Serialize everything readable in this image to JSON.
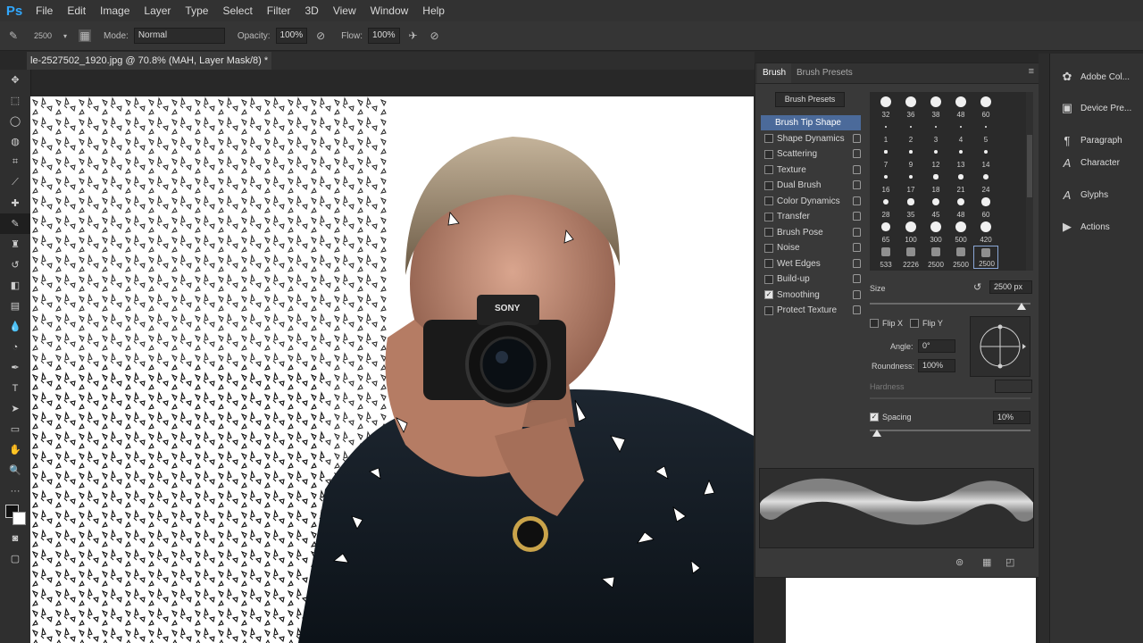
{
  "app": {
    "logo": "Ps"
  },
  "menu": [
    "File",
    "Edit",
    "Image",
    "Layer",
    "Type",
    "Select",
    "Filter",
    "3D",
    "View",
    "Window",
    "Help"
  ],
  "options": {
    "brush_size": "2500",
    "mode_label": "Mode:",
    "mode_value": "Normal",
    "opacity_label": "Opacity:",
    "opacity_value": "100%",
    "flow_label": "Flow:",
    "flow_value": "100%"
  },
  "document": {
    "tab_title": "le-2527502_1920.jpg @ 70.8% (MAH, Layer Mask/8) *"
  },
  "brush_panel": {
    "tabs": [
      "Brush",
      "Brush Presets"
    ],
    "presets_button": "Brush Presets",
    "list": [
      {
        "label": "Brush Tip Shape",
        "checkbox": false,
        "checked": false,
        "lock": false,
        "selected": true
      },
      {
        "label": "Shape Dynamics",
        "checkbox": true,
        "checked": false,
        "lock": true
      },
      {
        "label": "Scattering",
        "checkbox": true,
        "checked": false,
        "lock": true
      },
      {
        "label": "Texture",
        "checkbox": true,
        "checked": false,
        "lock": true
      },
      {
        "label": "Dual Brush",
        "checkbox": true,
        "checked": false,
        "lock": true
      },
      {
        "label": "Color Dynamics",
        "checkbox": true,
        "checked": false,
        "lock": true
      },
      {
        "label": "Transfer",
        "checkbox": true,
        "checked": false,
        "lock": true
      },
      {
        "label": "Brush Pose",
        "checkbox": true,
        "checked": false,
        "lock": true
      },
      {
        "label": "Noise",
        "checkbox": true,
        "checked": false,
        "lock": true
      },
      {
        "label": "Wet Edges",
        "checkbox": true,
        "checked": false,
        "lock": true
      },
      {
        "label": "Build-up",
        "checkbox": true,
        "checked": false,
        "lock": true
      },
      {
        "label": "Smoothing",
        "checkbox": true,
        "checked": true,
        "lock": true
      },
      {
        "label": "Protect Texture",
        "checkbox": true,
        "checked": false,
        "lock": true
      }
    ],
    "preset_rows": [
      [
        "32",
        "36",
        "38",
        "48",
        "60"
      ],
      [
        "1",
        "2",
        "3",
        "4",
        "5"
      ],
      [
        "7",
        "9",
        "12",
        "13",
        "14"
      ],
      [
        "16",
        "17",
        "18",
        "21",
        "24"
      ],
      [
        "28",
        "35",
        "45",
        "48",
        "60"
      ],
      [
        "65",
        "100",
        "300",
        "500",
        "420"
      ],
      [
        "533",
        "2226",
        "2500",
        "2500",
        "2500"
      ]
    ],
    "size_label": "Size",
    "size_value": "2500 px",
    "flip_x": "Flip X",
    "flip_y": "Flip Y",
    "angle_label": "Angle:",
    "angle_value": "0°",
    "roundness_label": "Roundness:",
    "roundness_value": "100%",
    "hardness_label": "Hardness",
    "spacing_label": "Spacing",
    "spacing_value": "10%",
    "spacing_checked": true
  },
  "right_dock": [
    "Adobe Col...",
    "Device Pre...",
    "Paragraph",
    "Character",
    "Glyphs",
    "Actions"
  ]
}
